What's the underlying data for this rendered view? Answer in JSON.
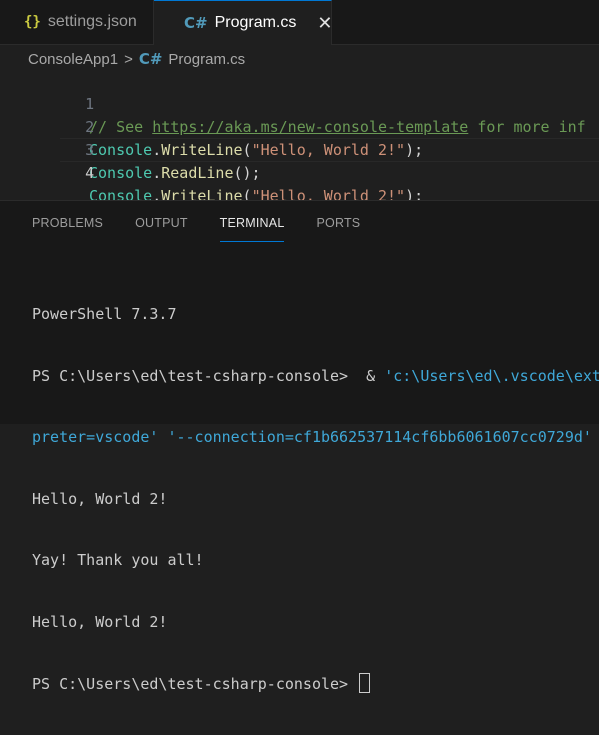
{
  "tabs": [
    {
      "icon": "{}",
      "label": "settings.json",
      "active": false
    },
    {
      "icon": "C#",
      "label": "Program.cs",
      "active": true,
      "close": "✕"
    }
  ],
  "breadcrumb": {
    "project": "ConsoleApp1",
    "separator": ">",
    "file_icon": "C#",
    "file": "Program.cs"
  },
  "editor": {
    "current_line": 4,
    "lines": [
      {
        "number": "1",
        "comment_prefix": "// See ",
        "url": "https://aka.ms/new-console-template",
        "comment_suffix": " for more inf"
      },
      {
        "number": "2",
        "class": "Console",
        "dot": ".",
        "method": "WriteLine",
        "open": "(",
        "string": "\"Hello, World 2!\"",
        "close": ");"
      },
      {
        "number": "3",
        "class": "Console",
        "dot": ".",
        "method": "ReadLine",
        "open": "();",
        "string": "",
        "close": ""
      },
      {
        "number": "4",
        "class": "Console",
        "dot": ".",
        "method": "WriteLine",
        "open": "(",
        "string": "\"Hello, World 2!\"",
        "close": ");"
      }
    ]
  },
  "panel": {
    "tabs": [
      "PROBLEMS",
      "OUTPUT",
      "TERMINAL",
      "PORTS"
    ],
    "active_tab": "TERMINAL"
  },
  "terminal": {
    "version": "PowerShell 7.3.7",
    "cmd_prompt": "PS C:\\Users\\ed\\test-csharp-console>  & ",
    "cmd_path": "'c:\\Users\\ed\\.vscode\\ext",
    "cmd_wrap": "preter=vscode' '--connection=cf1b662537114cf6bb6061607cc0729d'",
    "output": [
      "Hello, World 2!",
      "Yay! Thank you all!",
      "Hello, World 2!"
    ],
    "final_prompt": "PS C:\\Users\\ed\\test-csharp-console> "
  },
  "colors": {
    "accent": "#0078d4",
    "comment": "#6a9955",
    "class": "#4ec9b0",
    "method": "#dcdcaa",
    "string": "#ce9178"
  }
}
